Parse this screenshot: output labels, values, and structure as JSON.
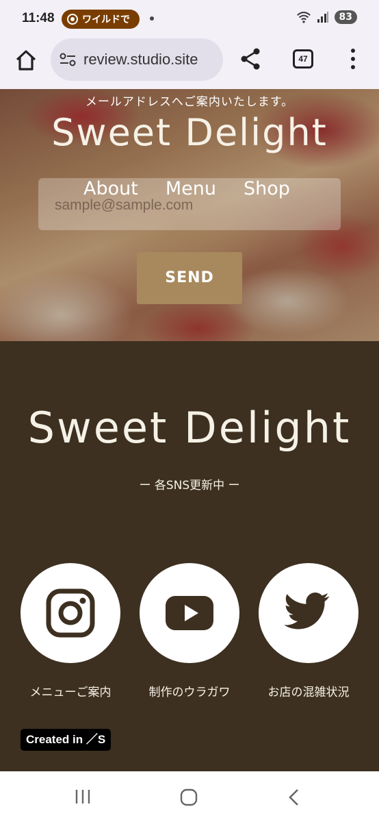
{
  "status_bar": {
    "time": "11:48",
    "notification_pill": "ワイルドで",
    "battery": "83"
  },
  "browser": {
    "url": "review.studio.site",
    "tab_count": "47"
  },
  "hero": {
    "note": "メールアドレスへご案内いたします。",
    "title": "Sweet Delight",
    "nav": [
      "About",
      "Menu",
      "Shop"
    ],
    "email_placeholder": "sample@sample.com",
    "send_label": "SEND"
  },
  "footer": {
    "title": "Sweet Delight",
    "subtitle": "ー 各SNS更新中 ー",
    "socials": [
      {
        "icon": "instagram-icon",
        "label": "メニューご案内"
      },
      {
        "icon": "youtube-icon",
        "label": "制作のウラガワ"
      },
      {
        "icon": "twitter-icon",
        "label": "お店の混雑状況"
      }
    ],
    "credit": "Created in ／S"
  },
  "colors": {
    "footer_bg": "#3d3020",
    "send_button": "#a8895d",
    "cream_text": "#f6f1e6"
  }
}
